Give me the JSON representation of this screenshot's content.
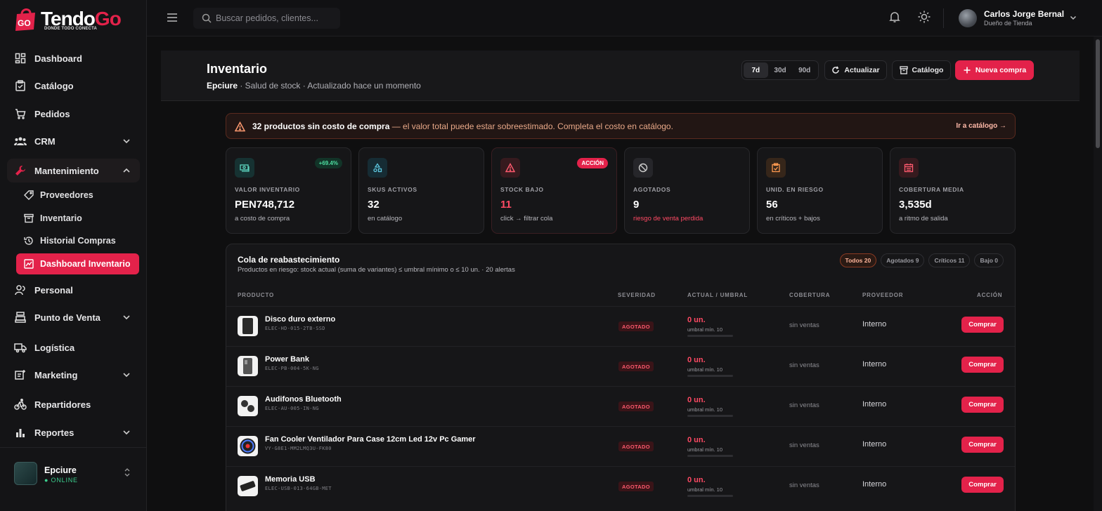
{
  "brand": {
    "name_part1": "Tendo",
    "name_part2": "Go",
    "tagline": "DONDE TODO CONECTA",
    "badge": "GO"
  },
  "sidebar": {
    "items": [
      {
        "label": "Dashboard"
      },
      {
        "label": "Catálogo"
      },
      {
        "label": "Pedidos"
      },
      {
        "label": "CRM"
      },
      {
        "label": "Mantenimiento"
      },
      {
        "label": "Personal"
      },
      {
        "label": "Punto de Venta"
      },
      {
        "label": "Logística"
      },
      {
        "label": "Marketing"
      },
      {
        "label": "Repartidores"
      },
      {
        "label": "Reportes"
      }
    ],
    "subitems": [
      {
        "label": "Proveedores"
      },
      {
        "label": "Inventario"
      },
      {
        "label": "Historial Compras"
      },
      {
        "label": "Dashboard Inventario"
      }
    ],
    "store": {
      "name": "Epciure",
      "status": "● ONLINE"
    }
  },
  "topbar": {
    "search_placeholder": "Buscar pedidos, clientes...",
    "user_name": "Carlos Jorge Bernal",
    "user_role": "Dueño de Tienda"
  },
  "header": {
    "title": "Inventario",
    "store": "Epciure",
    "subtitle": " · Salud de stock · Actualizado hace un momento",
    "ranges": [
      "7d",
      "30d",
      "90d"
    ],
    "refresh_label": "Actualizar",
    "catalog_label": "Catálogo",
    "new_purchase_label": "Nueva compra"
  },
  "alert": {
    "bold": "32 productos sin costo de compra",
    "text": " — el valor total puede estar sobreestimado. Completa el costo en catálogo.",
    "link": "Ir a catálogo →"
  },
  "kpis": [
    {
      "label": "VALOR INVENTARIO",
      "value": "PEN748,712",
      "note": "a costo de compra",
      "badge": "+69.4%"
    },
    {
      "label": "SKUS ACTIVOS",
      "value": "32",
      "note": "en catálogo"
    },
    {
      "label": "STOCK BAJO",
      "value": "11",
      "note": "click → filtrar cola",
      "badge": "ACCIÓN"
    },
    {
      "label": "AGOTADOS",
      "value": "9",
      "note": "riesgo de venta perdida"
    },
    {
      "label": "UNID. EN RIESGO",
      "value": "56",
      "note": "en críticos + bajos"
    },
    {
      "label": "COBERTURA MEDIA",
      "value": "3,535d",
      "note": "a ritmo de salida"
    }
  ],
  "queue": {
    "title": "Cola de reabastecimiento",
    "subtitle": "Productos en riesgo: stock actual (suma de variantes) ≤ umbral mínimo o ≤ 10 un. · 20 alertas",
    "chips": [
      "Todos 20",
      "Agotados 9",
      "Críticos 11",
      "Bajo 0"
    ],
    "columns": [
      "PRODUCTO",
      "SEVERIDAD",
      "ACTUAL / UMBRAL",
      "COBERTURA",
      "PROVEEDOR",
      "ACCIÓN"
    ],
    "rows": [
      {
        "name": "Disco duro externo",
        "sku": "ELEC-HD-015-2TB-SSD",
        "severity": "AGOTADO",
        "current": "0 un.",
        "threshold": "umbral mín. 10",
        "coverage": "sin ventas",
        "provider": "Interno",
        "action": "Comprar"
      },
      {
        "name": "Power Bank",
        "sku": "ELEC-PB-004-5K-NG",
        "severity": "AGOTADO",
        "current": "0 un.",
        "threshold": "umbral mín. 10",
        "coverage": "sin ventas",
        "provider": "Interno",
        "action": "Comprar"
      },
      {
        "name": "Audifonos Bluetooth",
        "sku": "ELEC-AU-005-IN-NG",
        "severity": "AGOTADO",
        "current": "0 un.",
        "threshold": "umbral mín. 10",
        "coverage": "sin ventas",
        "provider": "Interno",
        "action": "Comprar"
      },
      {
        "name": "Fan Cooler Ventilador Para Case 12cm Led 12v Pc Gamer",
        "sku": "VY-G8E1-MM2LMQ3U-FK80",
        "severity": "AGOTADO",
        "current": "0 un.",
        "threshold": "umbral mín. 10",
        "coverage": "sin ventas",
        "provider": "Interno",
        "action": "Comprar"
      },
      {
        "name": "Memoria USB",
        "sku": "ELEC-USB-013-64GB-MET",
        "severity": "AGOTADO",
        "current": "0 un.",
        "threshold": "umbral mín. 10",
        "coverage": "sin ventas",
        "provider": "Interno",
        "action": "Comprar"
      }
    ]
  },
  "colors": {
    "accent": "#e3224a",
    "danger": "#ff4a64",
    "online": "#3ccf8e"
  }
}
